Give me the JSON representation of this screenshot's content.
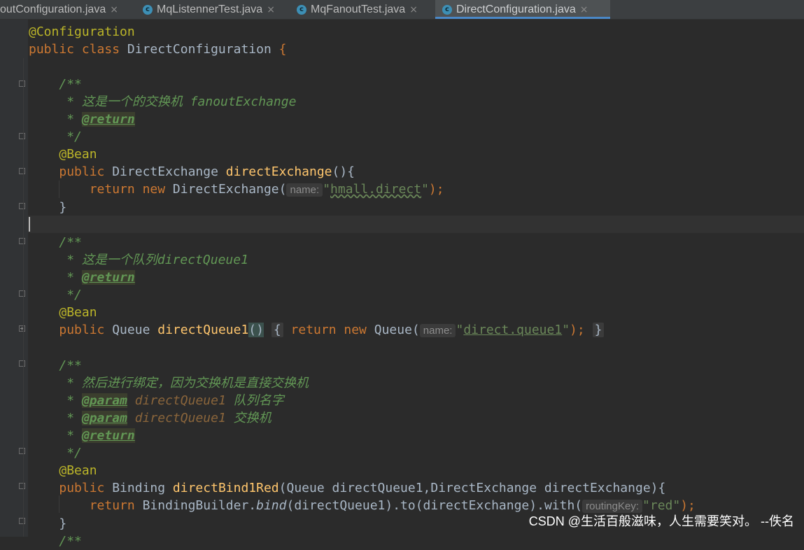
{
  "tabs": [
    {
      "label": "outConfiguration.java",
      "icon": "none",
      "active": false
    },
    {
      "label": "MqListennerTest.java",
      "icon": "class-icon",
      "active": false
    },
    {
      "label": "MqFanoutTest.java",
      "icon": "class-icon",
      "active": false
    },
    {
      "label": "DirectConfiguration.java",
      "icon": "class-icon",
      "active": true
    }
  ],
  "tab_icon_glyph": "c",
  "tab_close_glyph": "×",
  "code": {
    "l1": {
      "a": "@Configuration"
    },
    "l2": {
      "kw": "public class ",
      "name": "DirectConfiguration",
      "tail": " {"
    },
    "l4": {
      "c": "/**"
    },
    "l5": {
      "c": " * 这是一个的交换机 fanoutExchange"
    },
    "l6": {
      "c": " * ",
      "tag": "@return"
    },
    "l7": {
      "c": " */"
    },
    "l8": {
      "a": "@Bean"
    },
    "l9": {
      "kw": "public ",
      "type": "DirectExchange ",
      "fn": "directExchange",
      "tail": "(){"
    },
    "l10": {
      "kw1": "return ",
      "kw2": "new ",
      "cls": "DirectExchange(",
      "hint": "name:",
      "q1": "\"",
      "str": "hmall.direct",
      "q2": "\"",
      "tail": ");"
    },
    "l11": {
      "t": "}"
    },
    "l13": {
      "c": "/**"
    },
    "l14": {
      "c": " * 这是一个队列directQueue1"
    },
    "l15": {
      "c": " * ",
      "tag": "@return"
    },
    "l16": {
      "c": " */"
    },
    "l17": {
      "a": "@Bean"
    },
    "l18": {
      "kw": "public ",
      "type": "Queue ",
      "fn": "directQueue1",
      "paren": "()",
      "ob": "{",
      "kw2": "return ",
      "kw3": "new ",
      "cls": "Queue(",
      "hint": "name:",
      "q1": "\"",
      "str": "direct.queue1",
      "q2": "\"",
      "tail": ");",
      "cb": "}"
    },
    "l20": {
      "c": "/**"
    },
    "l21": {
      "c": " * 然后进行绑定，因为交换机是直接交换机"
    },
    "l22": {
      "c": " * ",
      "tag": "@param",
      "pname": " directQueue1",
      "rest": " 队列名字"
    },
    "l23": {
      "c": " * ",
      "tag": "@param",
      "pname": " directQueue1",
      "rest": " 交换机"
    },
    "l24": {
      "c": " * ",
      "tag": "@return"
    },
    "l25": {
      "c": " */"
    },
    "l26": {
      "a": "@Bean"
    },
    "l27": {
      "kw": "public ",
      "type": "Binding ",
      "fn": "directBind1Red",
      "tail": "(Queue directQueue1,DirectExchange directExchange){"
    },
    "l28": {
      "kw": "return ",
      "obj": "BindingBuilder.",
      "m": "bind",
      "p": "(directQueue1).to(directExchange).with(",
      "hint": "routingKey:",
      "str": "\"red\"",
      "tail": ");"
    },
    "l29": {
      "t": "}"
    },
    "l30": {
      "c": "/**"
    }
  },
  "watermark": "CSDN @生活百般滋味，人生需要笑对。 --佚名"
}
